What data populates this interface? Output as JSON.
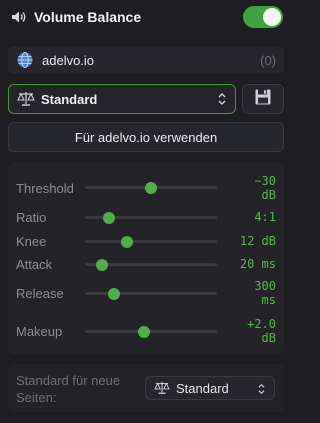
{
  "header": {
    "title": "Volume Balance",
    "enabled": true
  },
  "site": {
    "domain": "adelvo.io",
    "count": "(0)"
  },
  "preset": {
    "selected": "Standard"
  },
  "use_button": {
    "label": "Für adelvo.io verwenden"
  },
  "params": [
    {
      "label": "Threshold",
      "value_line1": "−30",
      "value_line2": "dB",
      "level": 0.5
    },
    {
      "label": "Ratio",
      "value_line1": "4:1",
      "value_line2": "",
      "level": 0.18
    },
    {
      "label": "Knee",
      "value_line1": "12 dB",
      "value_line2": "",
      "level": 0.32
    },
    {
      "label": "Attack",
      "value_line1": "20 ms",
      "value_line2": "",
      "level": 0.13
    },
    {
      "label": "Release",
      "value_line1": "300",
      "value_line2": "ms",
      "level": 0.22
    },
    {
      "label": "Makeup",
      "value_line1": "+2.0",
      "value_line2": "dB",
      "level": 0.45
    }
  ],
  "footer": {
    "label": "Standard für neue Seiten:",
    "selected": "Standard"
  },
  "colors": {
    "accent": "#4fae47",
    "value_text": "#57b84d",
    "background": "#1d1d22"
  }
}
